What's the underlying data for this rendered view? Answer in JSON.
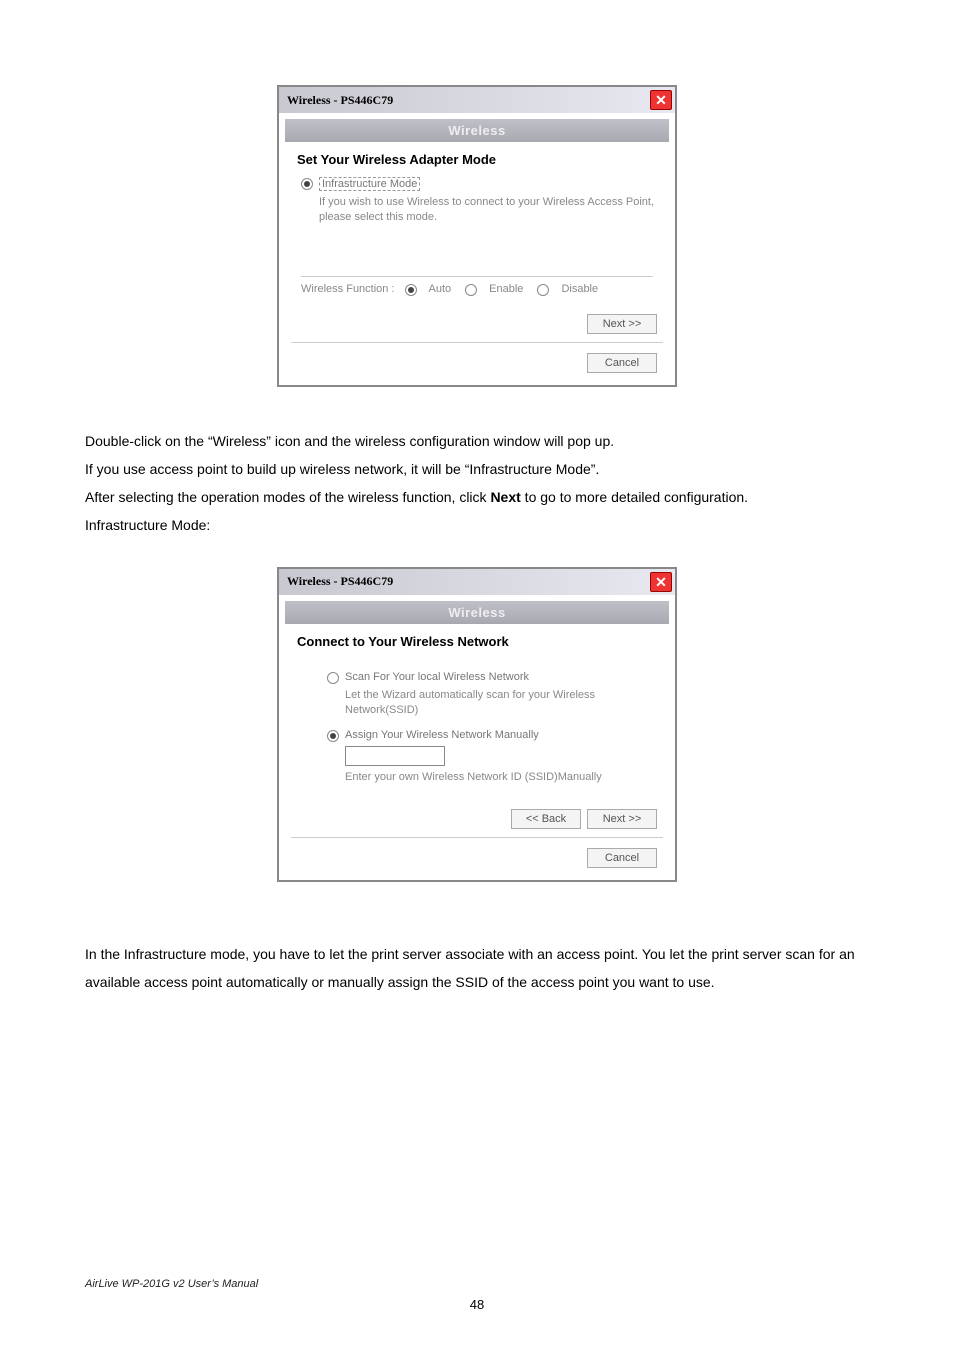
{
  "dialog1": {
    "title": "Wireless - PS446C79",
    "header": "Wireless",
    "section_title": "Set Your Wireless Adapter Mode",
    "radio_main_label": "Infrastructure Mode",
    "radio_main_desc": "If you wish to use Wireless to connect to your Wireless Access Point, please select this mode.",
    "func_label": "Wireless Function :",
    "opt_auto": "Auto",
    "opt_enable": "Enable",
    "opt_disable": "Disable",
    "next_label": "Next >>",
    "cancel_label": "Cancel"
  },
  "para1_a": "Double-click on the “Wireless” icon and the wireless configuration window will pop up.",
  "para1_b": "If you use access point to build up wireless network, it will be “Infrastructure Mode”.",
  "para1_c_pre": "After selecting the operation modes of the wireless function, click ",
  "para1_c_bold": "Next",
  "para1_c_post": " to go to more detailed configuration.",
  "para1_d": "Infrastructure Mode:",
  "dialog2": {
    "title": "Wireless - PS446C79",
    "header": "Wireless",
    "section_title": "Connect to Your Wireless Network",
    "opt_scan_label": "Scan For Your local Wireless Network",
    "opt_scan_desc": "Let the Wizard automatically scan for your Wireless Network(SSID)",
    "opt_manual_label": "Assign Your Wireless Network Manually",
    "opt_manual_desc": "Enter your own Wireless Network ID (SSID)Manually",
    "back_label": "<< Back",
    "next_label": "Next >>",
    "cancel_label": "Cancel"
  },
  "para2": "In the Infrastructure mode, you have to let the print server associate with an access point. You let the print server scan for an available access point automatically or manually assign the SSID of the access point you want to use.",
  "footer": "AirLive WP-201G v2 User’s Manual",
  "page_number": "48"
}
